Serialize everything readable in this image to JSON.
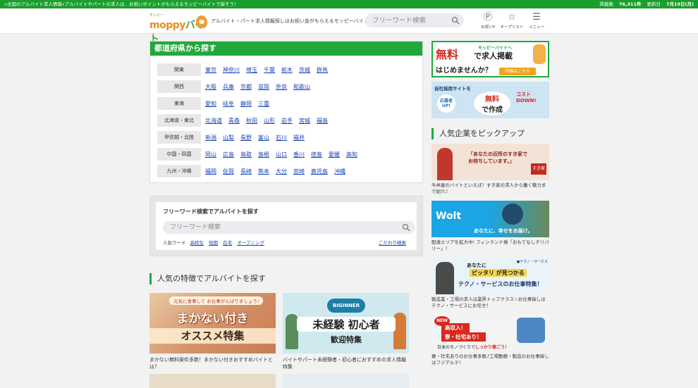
{
  "topbar": {
    "message": "»全国のアルバイト求人情報»アルバイトやパートの求人は、お祝いポイントがもらえるモッピーバイトで探そう！",
    "listing_label": "掲載数",
    "listing_count": "76,311件",
    "updated_label": "更新日",
    "updated_date": "7月19日(月)"
  },
  "header": {
    "logo_small": "モッピー",
    "logo_text_m": "moppy",
    "logo_text_b": "バイト",
    "tagline": "アルバイト・パート求人情報探しはお祝い金がもらえるモッピーバイト",
    "search_placeholder": "フリーワード検索",
    "nav": [
      {
        "label": "お祝いP",
        "glyph": "Ⓟ",
        "icon": "points-icon"
      },
      {
        "label": "キープリスト",
        "glyph": "☆",
        "icon": "star-icon"
      },
      {
        "label": "メニュー",
        "glyph": "☰",
        "icon": "menu-icon"
      }
    ]
  },
  "prefecture": {
    "title": "都道府県から探す",
    "rows": [
      {
        "region": "関東",
        "prefs": [
          "東京",
          "神奈川",
          "埼玉",
          "千葉",
          "栃木",
          "茨城",
          "群馬"
        ]
      },
      {
        "region": "関西",
        "prefs": [
          "大阪",
          "兵庫",
          "京都",
          "滋賀",
          "奈良",
          "和歌山"
        ]
      },
      {
        "region": "東海",
        "prefs": [
          "愛知",
          "岐阜",
          "静岡",
          "三重"
        ]
      },
      {
        "region": "北海道・東北",
        "prefs": [
          "北海道",
          "青森",
          "秋田",
          "山形",
          "岩手",
          "宮城",
          "福島"
        ]
      },
      {
        "region": "甲信越・北陸",
        "prefs": [
          "新潟",
          "山梨",
          "長野",
          "富山",
          "石川",
          "福井"
        ]
      },
      {
        "region": "中国・四国",
        "prefs": [
          "岡山",
          "広島",
          "鳥取",
          "島根",
          "山口",
          "香川",
          "徳島",
          "愛媛",
          "高知"
        ]
      },
      {
        "region": "九州・沖縄",
        "prefs": [
          "福岡",
          "佐賀",
          "長崎",
          "熊本",
          "大分",
          "宮崎",
          "鹿児島",
          "沖縄"
        ]
      }
    ]
  },
  "freeword": {
    "title": "フリーワード検索でアルバイトを探す",
    "placeholder": "フリーワード検索",
    "popular_label": "人気ワード",
    "popular": [
      "高校生",
      "短期",
      "在宅",
      "オープニング"
    ],
    "advanced": "こだわり検索"
  },
  "features": {
    "title": "人気の特徴でアルバイトを探す",
    "items": [
      {
        "ribbon": "元気に食事して お仕事がんばりましょう!",
        "big": "まかない付き",
        "sub": "オススメ特集",
        "caption": "まかない無料案件多数！まかない付きおすすめバイトとは？"
      },
      {
        "tag": "BIGINNER",
        "big": "未経験 初心者",
        "sub": "歓迎特集",
        "caption": "バイトやパート未経験者・初心者におすすめの求人情報特集"
      }
    ]
  },
  "sidebar": {
    "ad1": {
      "free": "無料",
      "line1": "モッピーバイトへ",
      "line2": "で求人掲載",
      "line3": "はじめませんか？",
      "button": "詳細はこちら"
    },
    "ad2": {
      "line1": "自社採用サイトを",
      "circle": "応募者 UP!",
      "red": "無料",
      "black": "で作成",
      "cost": "コスト DOWN!"
    },
    "pick_title": "人気企業をピックアップ",
    "picks": [
      {
        "banner": "「あなたの近所のすき家でお待ちしています。」",
        "logo": "すき家",
        "caption": "牛丼屋のバイトといえば！すき家の求人から働く魅力まで紹介♪"
      },
      {
        "banner_logo": "Wolt",
        "banner": "あなたに、幸せをお届け。",
        "caption": "配達エリアを拡大中! フィンランド発「おもてなしデリバリー」！"
      },
      {
        "brand": "●テクノ・サービス",
        "tl": "あなたに",
        "hl": "ピッタリ が見つかる",
        "bl": "テクノ・サービスのお仕事特集！",
        "caption": "製造業・工場の求人は業界トップクラス☆お仕事探しはテクノ・サービスにお任せ！"
      },
      {
        "new": "NEW",
        "b1": "高収入！",
        "b2": "寮・社宅あり！",
        "bt_pre": "日本のモノづくりで",
        "bt_hl": "しっかり稼ごう！",
        "caption": "寮・社宅ありのお仕事多数♪工場勤務・製造のお仕事探しはフジアルテ！"
      }
    ]
  }
}
